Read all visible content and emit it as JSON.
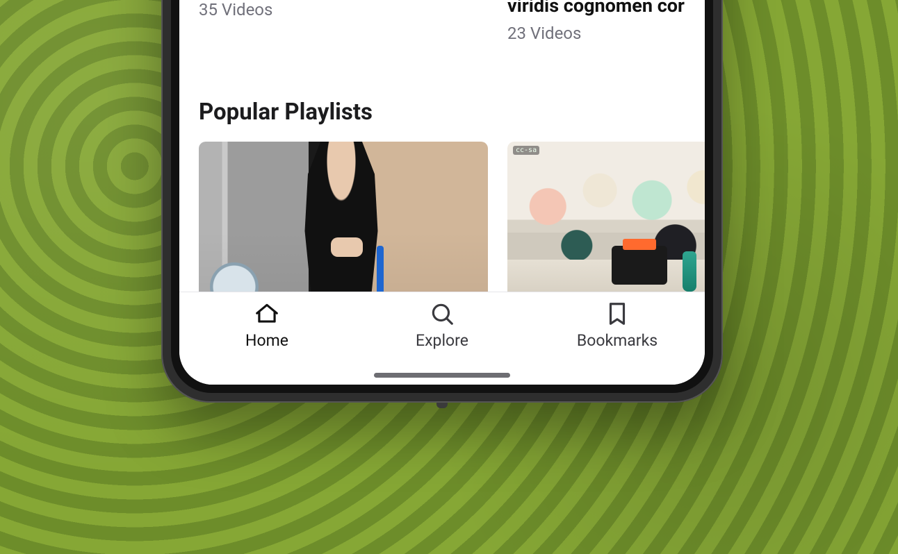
{
  "top_row": {
    "left": {
      "count": "35 Videos"
    },
    "right": {
      "title": "viridis cognomen cor",
      "count": "23 Videos"
    }
  },
  "section_heading": "Popular Playlists",
  "thumb2_badge": "cc-sa",
  "tabs": {
    "home": "Home",
    "explore": "Explore",
    "bookmarks": "Bookmarks"
  }
}
